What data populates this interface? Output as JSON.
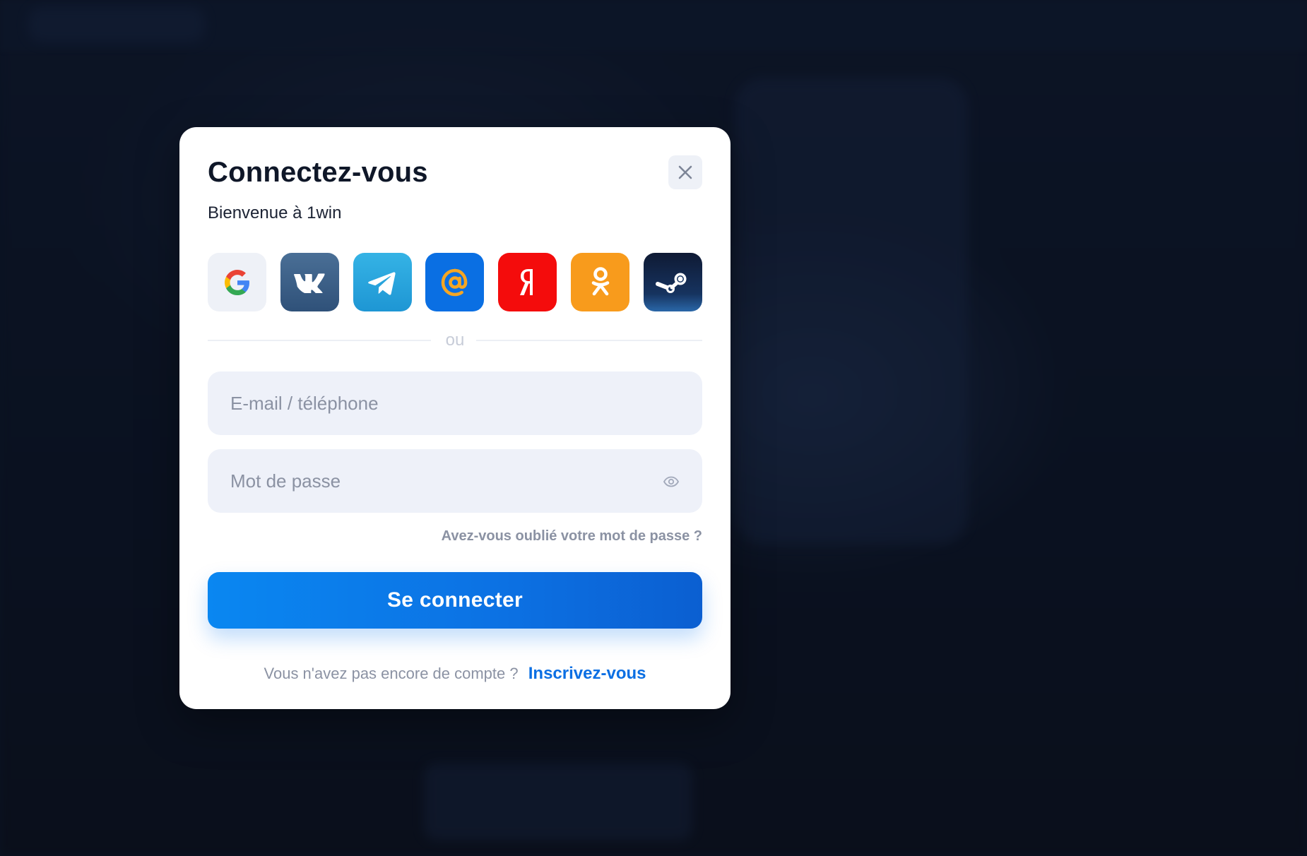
{
  "modal": {
    "title": "Connectez-vous",
    "subtitle": "Bienvenue à 1win"
  },
  "social_logins": [
    {
      "name": "google",
      "icon": "google-icon",
      "color": "#eef1f7"
    },
    {
      "name": "vk",
      "icon": "vk-icon",
      "color": "#3b5f89"
    },
    {
      "name": "telegram",
      "icon": "telegram-icon",
      "color": "#27a7e7"
    },
    {
      "name": "mail.ru",
      "icon": "at-sign-icon",
      "color": "#0a6fe3"
    },
    {
      "name": "yandex",
      "icon": "yandex-icon",
      "color": "#f40c0c"
    },
    {
      "name": "odnoklassniki",
      "icon": "odnoklassniki-icon",
      "color": "#f89b1c"
    },
    {
      "name": "steam",
      "icon": "steam-icon",
      "color": "#16335f"
    }
  ],
  "divider": {
    "text": "ou"
  },
  "form": {
    "email_value": "",
    "email_placeholder": "E-mail / téléphone",
    "password_value": "",
    "password_placeholder": "Mot de passe",
    "forgot_label": "Avez-vous oublié votre mot de passe ?",
    "submit_label": "Se connecter"
  },
  "footer": {
    "prompt": "Vous n'avez pas encore de compte ?",
    "signup_label": "Inscrivez-vous"
  },
  "colors": {
    "primary": "#0b6fe3",
    "input_bg": "#eef1f9",
    "overlay_bg": "#0b1322"
  }
}
